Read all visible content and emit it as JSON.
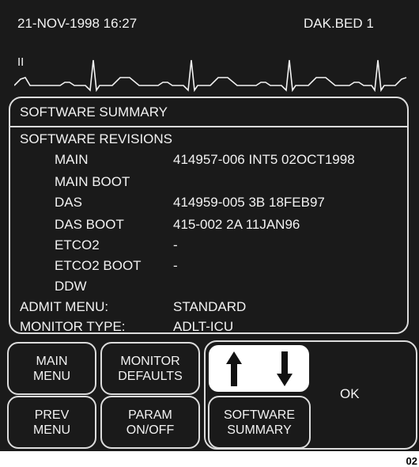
{
  "header": {
    "date_time": "21-NOV-1998  16:27",
    "bed": "DAK.BED 1"
  },
  "waveform": {
    "lead": "II"
  },
  "summary": {
    "title": "SOFTWARE SUMMARY",
    "revisions_heading": "SOFTWARE REVISIONS",
    "rows": [
      {
        "label": "MAIN",
        "value": "414957-006 INT5 02OCT1998"
      },
      {
        "label": "MAIN BOOT",
        "value": ""
      },
      {
        "label": "DAS",
        "value": "414959-005 3B 18FEB97"
      },
      {
        "label": "DAS BOOT",
        "value": "415-002 2A 11JAN96"
      },
      {
        "label": "ETCO2",
        "value": "-"
      },
      {
        "label": "ETCO2 BOOT",
        "value": "-"
      },
      {
        "label": "DDW",
        "value": ""
      }
    ],
    "admit_menu_label": "ADMIT MENU:",
    "admit_menu_value": "STANDARD",
    "monitor_type_label": "MONITOR TYPE:",
    "monitor_type_value": "ADLT-ICU"
  },
  "buttons": {
    "main_menu": [
      "MAIN",
      "MENU"
    ],
    "monitor_defaults": [
      "MONITOR",
      "DEFAULTS"
    ],
    "prev_menu": [
      "PREV",
      "MENU"
    ],
    "param_onoff": [
      "PARAM",
      "ON/OFF"
    ],
    "software_summary": [
      "SOFTWARE",
      "SUMMARY"
    ],
    "ok": "OK"
  },
  "figure_code": "02"
}
